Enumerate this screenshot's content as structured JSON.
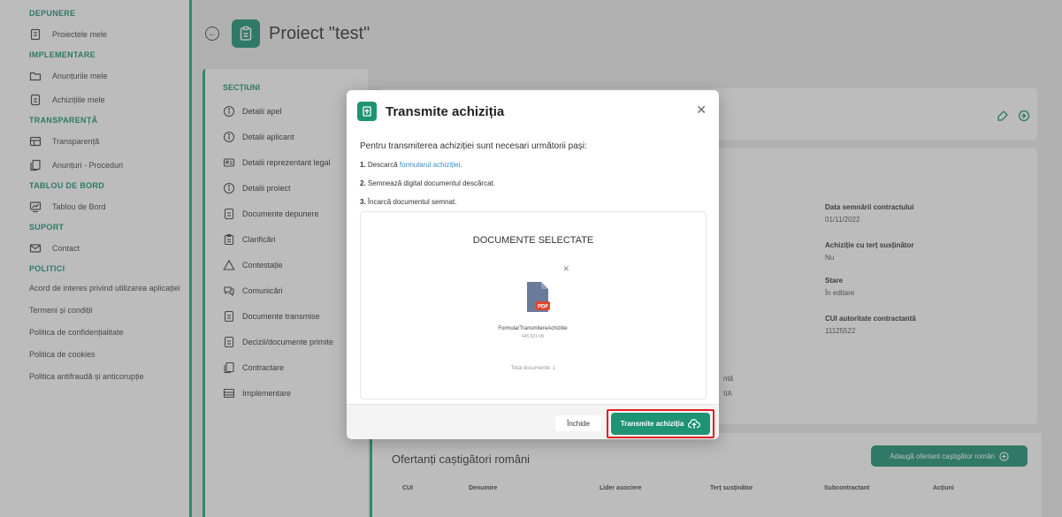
{
  "sidebar": {
    "sections": [
      {
        "title": "DEPUNERE",
        "items": [
          {
            "label": "Proiectele mele",
            "icon": "document-icon"
          }
        ]
      },
      {
        "title": "IMPLEMENTARE",
        "items": [
          {
            "label": "Anunțurile mele",
            "icon": "folder-icon"
          },
          {
            "label": "Achizițiile mele",
            "icon": "file-icon"
          }
        ]
      },
      {
        "title": "TRANSPARENȚĂ",
        "items": [
          {
            "label": "Transparență",
            "icon": "table-icon"
          },
          {
            "label": "Anunțuri - Proceduri",
            "icon": "copy-icon"
          }
        ]
      },
      {
        "title": "TABLOU DE BORD",
        "items": [
          {
            "label": "Tablou de Bord",
            "icon": "dashboard-icon"
          }
        ]
      },
      {
        "title": "SUPORT",
        "items": [
          {
            "label": "Contact",
            "icon": "mail-icon"
          }
        ]
      },
      {
        "title": "POLITICI",
        "items": []
      }
    ],
    "policies": [
      "Acord de interes privind utilizarea aplicației",
      "Termeni și condiții",
      "Politica de confidențialitate",
      "Politica de cookies",
      "Politica antifraudă și anticorupție"
    ]
  },
  "header": {
    "title": "Proiect \"test\""
  },
  "sections_panel": {
    "title": "SECȚIUNI",
    "items": [
      {
        "label": "Detalii apel",
        "icon": "info-icon"
      },
      {
        "label": "Detalii aplicant",
        "icon": "info-icon"
      },
      {
        "label": "Detalii reprezentant legal",
        "icon": "id-card-icon"
      },
      {
        "label": "Detalii proiect",
        "icon": "info-icon"
      },
      {
        "label": "Documente depunere",
        "icon": "file-icon"
      },
      {
        "label": "Clarificări",
        "icon": "clipboard-icon"
      },
      {
        "label": "Contestație",
        "icon": "warning-icon"
      },
      {
        "label": "Comunicări",
        "icon": "chat-icon"
      },
      {
        "label": "Documente transmise",
        "icon": "file-icon"
      },
      {
        "label": "Decizii/documente primite",
        "icon": "file-icon"
      },
      {
        "label": "Contractare",
        "icon": "copy-icon"
      },
      {
        "label": "Implementare",
        "icon": "table-icon"
      }
    ]
  },
  "details": [
    {
      "label": "Data semnării contractului",
      "value": "01/11/2022"
    },
    {
      "label": "Achiziție cu terț susținător",
      "value": "Nu"
    },
    {
      "label": "Stare",
      "value": "În editare"
    },
    {
      "label": "CUI autoritate contractantă",
      "value": "11125522"
    }
  ],
  "partial_texts": [
    "ntă",
    "IIA"
  ],
  "bottom": {
    "title": "Ofertanți caștigători români",
    "add_button": "Adaugă ofertant caștigător român",
    "columns": [
      "CUI",
      "Denumire",
      "Lider asociere",
      "Terț susținător",
      "Subcontractant",
      "Acțiuni"
    ]
  },
  "modal": {
    "title": "Transmite achiziția",
    "intro": "Pentru transmiterea achiziției sunt necesari următorii pași:",
    "steps": [
      {
        "num": "1.",
        "text": "Descarcă ",
        "link": "formularul achiziției",
        "suffix": "."
      },
      {
        "num": "2.",
        "text": "Semnează digital documentul descărcat.",
        "link": "",
        "suffix": ""
      },
      {
        "num": "3.",
        "text": "Încarcă documentul semnat.",
        "link": "",
        "suffix": ""
      }
    ],
    "docs_title": "DOCUMENTE SELECTATE",
    "file": {
      "name": "FormularTransmitereAchizitie",
      "size": "445.621 kB",
      "badge": "PDF"
    },
    "total": "Total documente: 1",
    "close_label": "Închide",
    "submit_label": "Transmite achiziția"
  },
  "colors": {
    "accent": "#1e9474",
    "highlight": "#e02020",
    "link": "#3a8fc2",
    "pdf": "#e0452e"
  }
}
